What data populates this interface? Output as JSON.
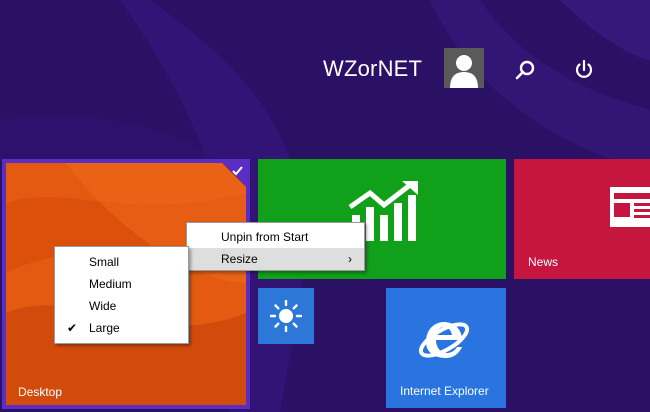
{
  "header": {
    "user_name": "WZorNET",
    "icons": [
      "avatar",
      "search-icon",
      "power-icon"
    ]
  },
  "tiles": {
    "desktop": {
      "label": "Desktop",
      "selected": true
    },
    "finance": {
      "label": "",
      "icon": "finance-chart-icon"
    },
    "news": {
      "label": "News",
      "icon": "newspaper-icon"
    },
    "weather": {
      "label": "",
      "icon": "sun-icon"
    },
    "ie": {
      "label": "Internet Explorer",
      "icon": "internet-explorer-icon"
    }
  },
  "context_menu": {
    "items": [
      {
        "label": "Unpin from Start"
      },
      {
        "label": "Resize",
        "has_submenu": true,
        "chevron": "›"
      }
    ]
  },
  "resize_submenu": {
    "items": [
      {
        "label": "Small",
        "checked": false
      },
      {
        "label": "Medium",
        "checked": false
      },
      {
        "label": "Wide",
        "checked": false
      },
      {
        "label": "Large",
        "checked": true,
        "check_glyph": "✔"
      }
    ]
  },
  "colors": {
    "background": "#2a1063",
    "selection": "#5a2ec2",
    "desktop_tile": "#e8560c",
    "finance_tile": "#10a01a",
    "news_tile": "#c4163e",
    "weather_tile": "#2d77d9",
    "ie_tile": "#2a74e0"
  }
}
